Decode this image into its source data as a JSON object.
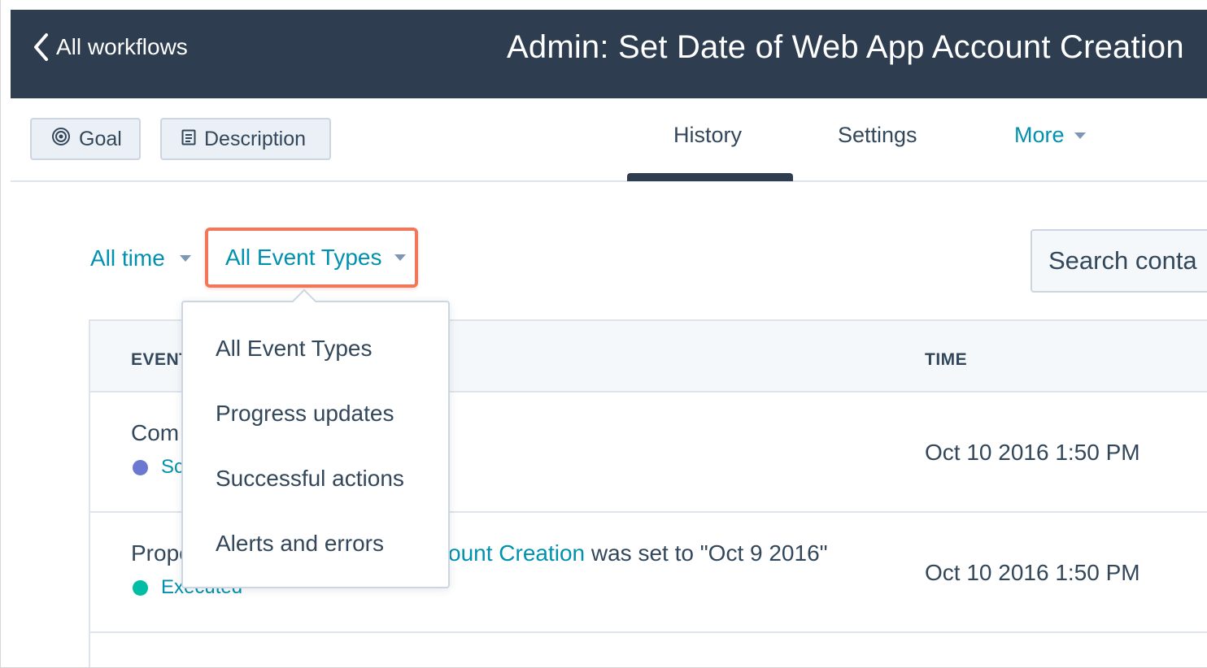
{
  "header": {
    "back_label": "All workflows",
    "workflow_title": "Admin: Set Date of Web App Account Creation"
  },
  "toolbar": {
    "goal_label": "Goal",
    "description_label": "Description",
    "tabs": [
      {
        "label": "History",
        "active": true
      },
      {
        "label": "Settings",
        "active": false
      },
      {
        "label": "More",
        "active": false
      }
    ]
  },
  "filters": {
    "time_label": "All time",
    "event_types_label": "All Event Types",
    "search_placeholder": "Search conta"
  },
  "table": {
    "columns": [
      "EVENT",
      "TIME"
    ],
    "rows": [
      {
        "description": "Com",
        "status": "Sc",
        "status_color": "#6a78d1",
        "time": "Oct 10 2016 1:50 PM"
      },
      {
        "description": "Prope",
        "link_text": "ount Creation",
        "tail_text": " was set to \"Oct 9 2016\"",
        "status": "Executed",
        "status_color": "#00bda5",
        "time": "Oct 10 2016 1:50 PM"
      }
    ]
  },
  "dropdown": {
    "items": [
      "All Event Types",
      "Progress updates",
      "Successful actions",
      "Alerts and errors"
    ]
  },
  "colors": {
    "header_bg": "#2e3e50",
    "accent": "#0091ae",
    "highlight": "#f2775a"
  }
}
